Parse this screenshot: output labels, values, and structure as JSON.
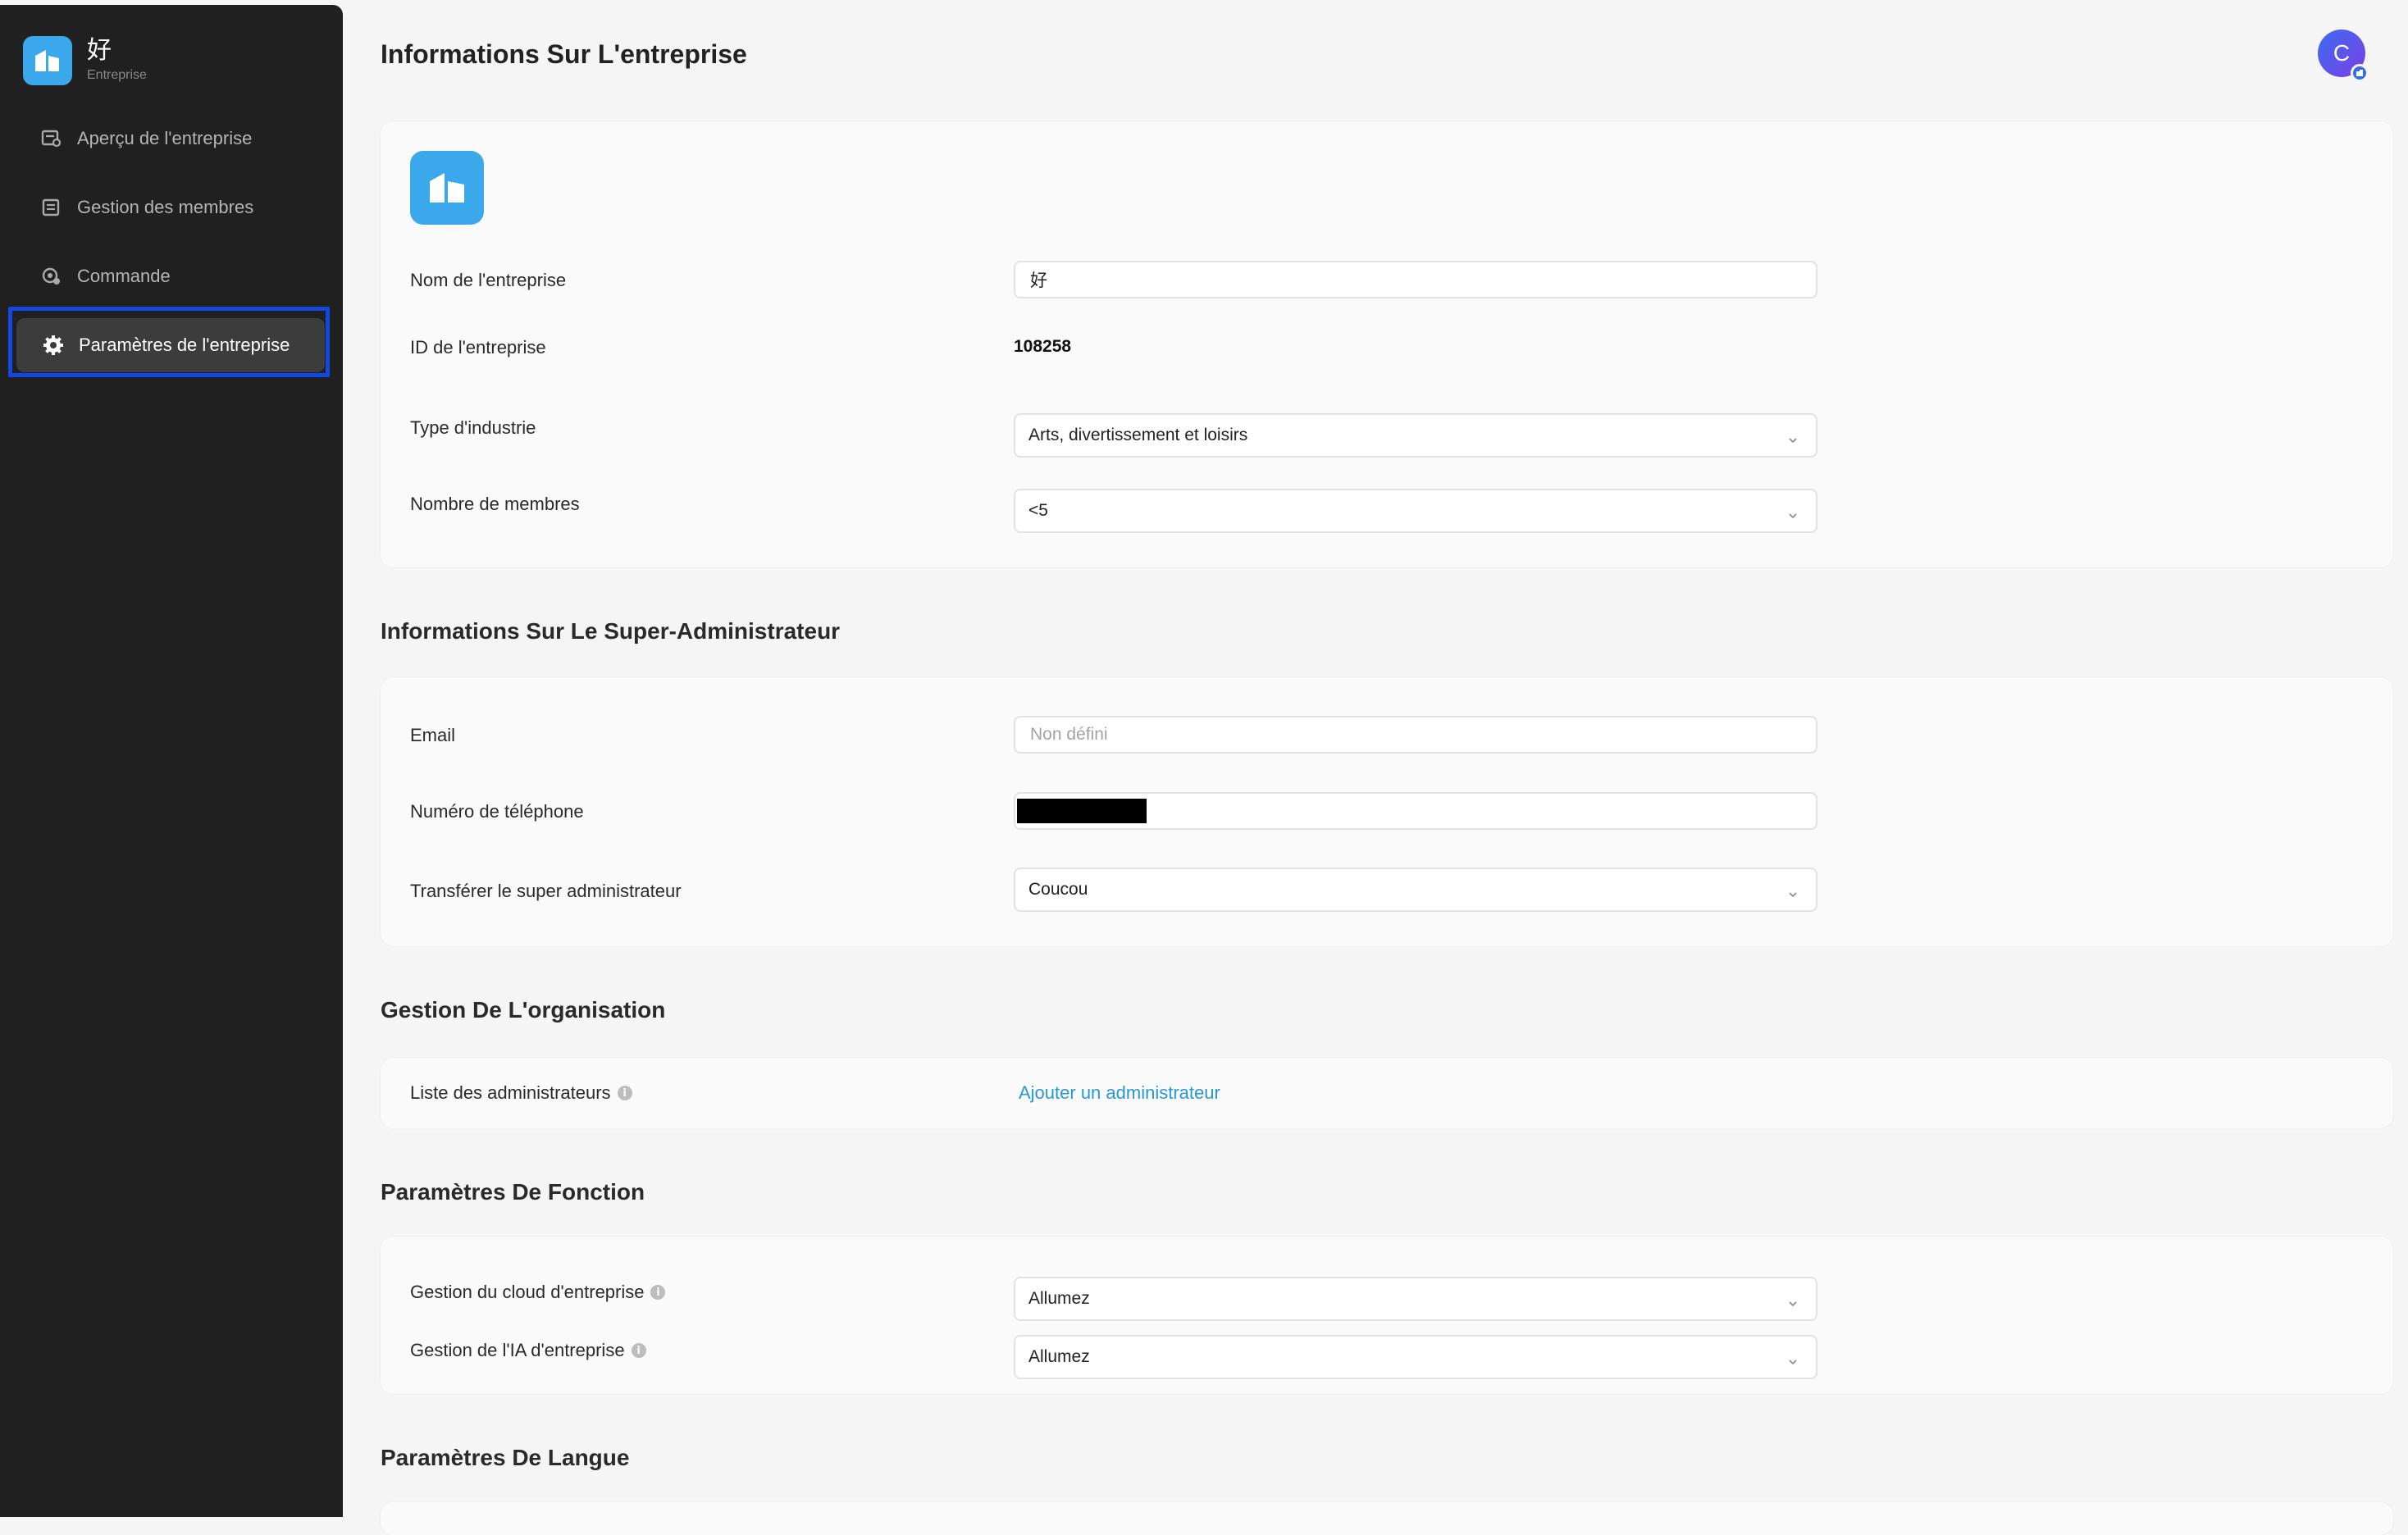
{
  "sidebar": {
    "brand": {
      "name": "好",
      "subtitle": "Entreprise"
    },
    "items": [
      {
        "label": "Aperçu de l'entreprise",
        "icon": "overview-icon",
        "active": false
      },
      {
        "label": "Gestion des membres",
        "icon": "members-icon",
        "active": false
      },
      {
        "label": "Commande",
        "icon": "order-icon",
        "active": false
      },
      {
        "label": "Paramètres de l'entreprise",
        "icon": "gear-icon",
        "active": true
      }
    ]
  },
  "header": {
    "title": "Informations Sur L'entreprise",
    "avatar_letter": "C"
  },
  "company": {
    "name_label": "Nom de l'entreprise",
    "name_value": "好",
    "id_label": "ID de l'entreprise",
    "id_value": "108258",
    "industry_label": "Type d'industrie",
    "industry_value": "Arts, divertissement et loisirs",
    "members_label": "Nombre de membres",
    "members_value": "<5"
  },
  "super_admin": {
    "title": "Informations Sur Le Super-Administrateur",
    "email_label": "Email",
    "email_placeholder": "Non défini",
    "phone_label": "Numéro de téléphone",
    "transfer_label": "Transférer le super administrateur",
    "transfer_value": "Coucou"
  },
  "organisation": {
    "title": "Gestion De L'organisation",
    "admins_label": "Liste des administrateurs",
    "add_admin_link": "Ajouter un administrateur"
  },
  "features": {
    "title": "Paramètres De Fonction",
    "cloud_label": "Gestion du cloud d'entreprise",
    "cloud_value": "Allumez",
    "ai_label": "Gestion de l'IA d'entreprise",
    "ai_value": "Allumez"
  },
  "language": {
    "title": "Paramètres De Langue"
  },
  "colors": {
    "sidebar_bg": "#202020",
    "accent": "#3aa8ea",
    "link": "#2a97d6",
    "highlight_border": "#1247e0"
  }
}
